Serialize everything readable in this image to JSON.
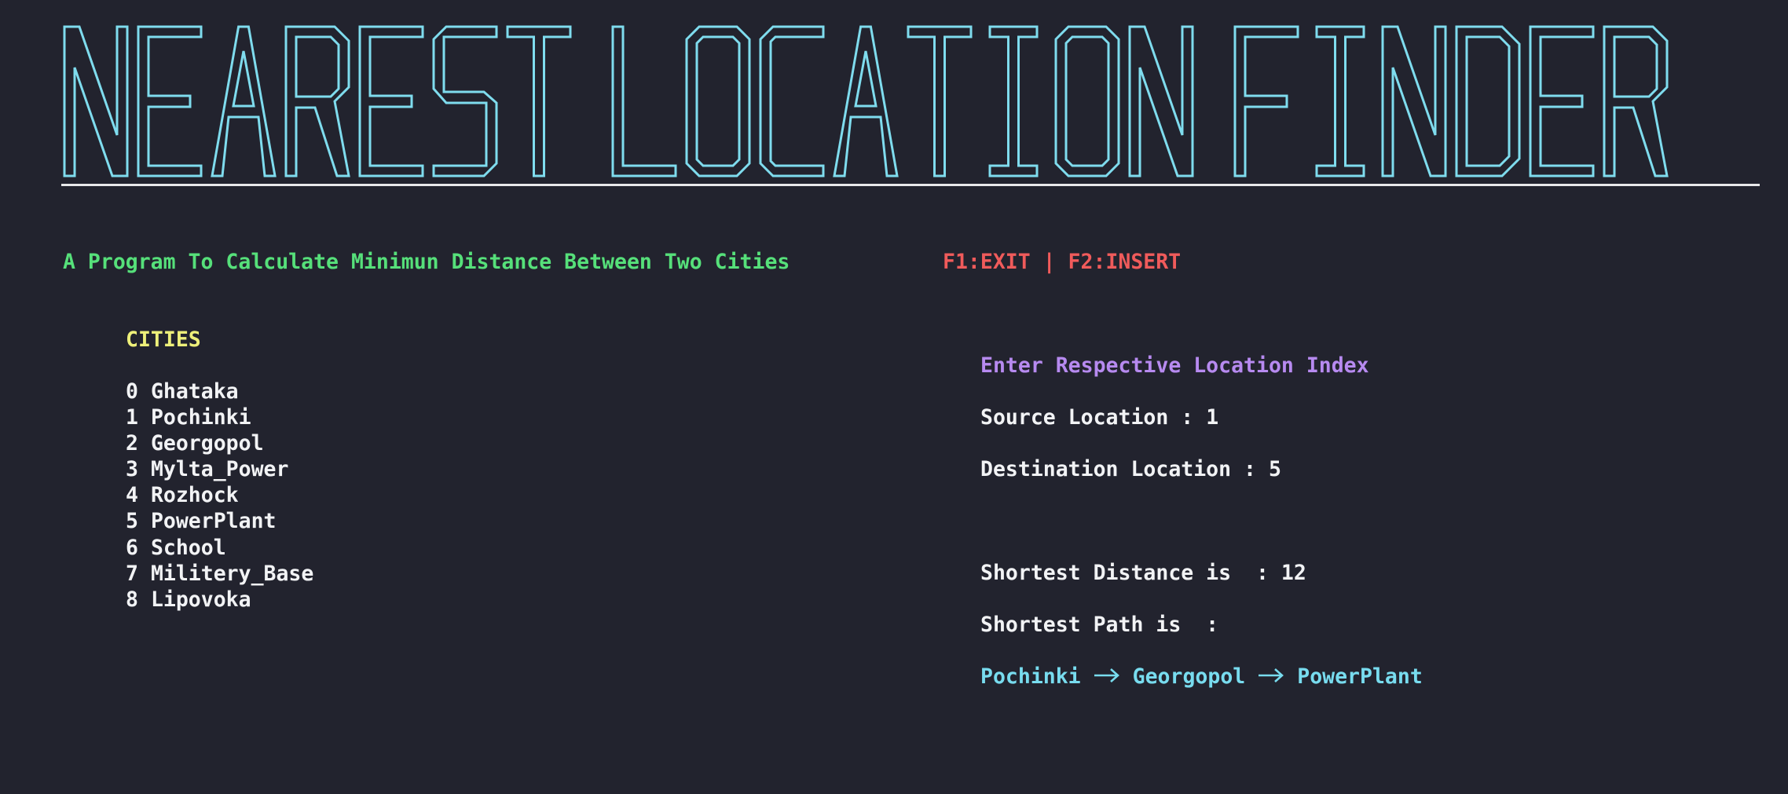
{
  "banner": {
    "title": "NEAREST LOCATION FINDER",
    "color": "#7fdcee"
  },
  "header": {
    "subtitle": "A Program To Calculate Minimun Distance Between Two Cities",
    "keys": "F1:EXIT | F2:INSERT"
  },
  "cities": {
    "heading": "CITIES",
    "items": [
      {
        "index": "0",
        "name": "Ghataka"
      },
      {
        "index": "1",
        "name": "Pochinki"
      },
      {
        "index": "2",
        "name": "Georgopol"
      },
      {
        "index": "3",
        "name": "Mylta_Power"
      },
      {
        "index": "4",
        "name": "Rozhock"
      },
      {
        "index": "5",
        "name": "PowerPlant"
      },
      {
        "index": "6",
        "name": "School"
      },
      {
        "index": "7",
        "name": "Militery_Base"
      },
      {
        "index": "8",
        "name": "Lipovoka"
      }
    ]
  },
  "query": {
    "prompt": "Enter Respective Location Index",
    "source_label": "Source Location : ",
    "source_value": "1",
    "destination_label": "Destination Location : ",
    "destination_value": "5"
  },
  "result": {
    "distance_label": "Shortest Distance is  : ",
    "distance_value": "12",
    "path_label": "Shortest Path is  :",
    "path": [
      "Pochinki",
      "Georgopol",
      "PowerPlant"
    ],
    "arrow_icon": "long-right-arrow-icon"
  },
  "colors": {
    "background": "#22232e",
    "banner": "#7fdcee",
    "subtitle": "#56e07a",
    "keys": "#f05b5b",
    "heading": "#eef07a",
    "prompt": "#b78af0",
    "path": "#78dcef",
    "text": "#f2f3f5"
  }
}
